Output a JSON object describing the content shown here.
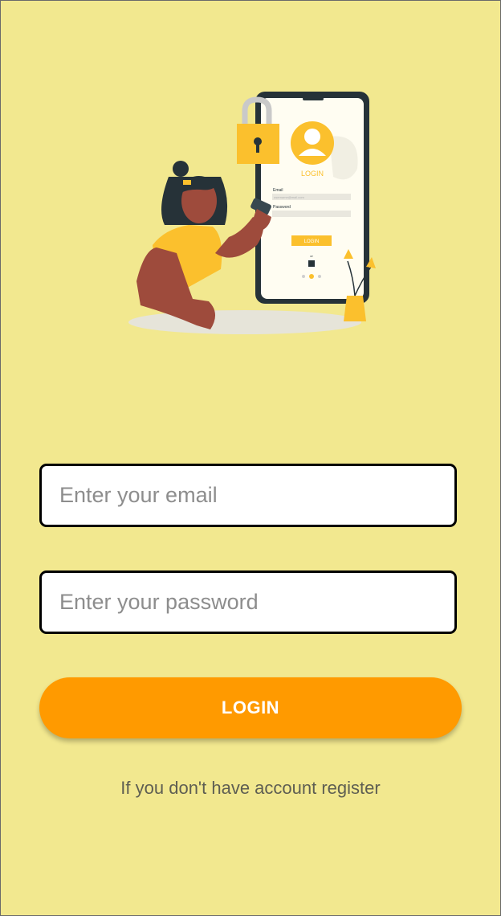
{
  "illustration": {
    "icon": "login-illustration",
    "phone_login_title": "LOGIN",
    "phone_email_label": "Email",
    "phone_email_placeholder": "username@mail.com",
    "phone_password_label": "Password",
    "phone_button_label": "LOGIN",
    "phone_or_label": "or"
  },
  "form": {
    "email_placeholder": "Enter your email",
    "password_placeholder": "Enter your password",
    "login_label": "LOGIN",
    "register_text": "If you don't have account register"
  },
  "colors": {
    "background": "#f2e88f",
    "button": "#ff9a00",
    "accent_yellow": "#fbc02d"
  }
}
